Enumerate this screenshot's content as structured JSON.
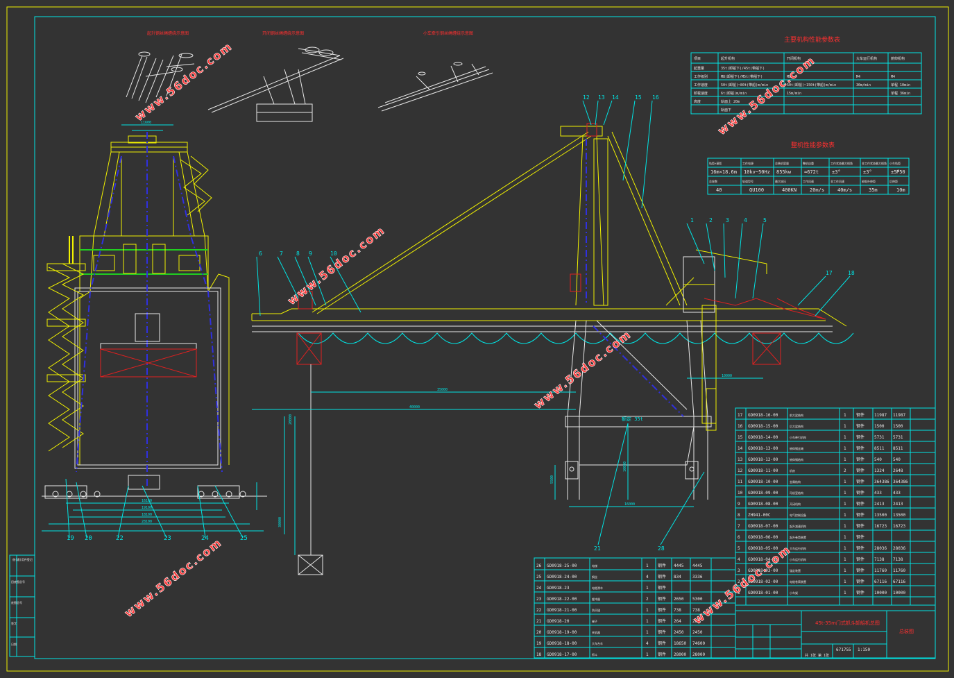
{
  "watermark": "www.56doc.com",
  "detail_titles": [
    "起升钢丝绳缠绕示意图",
    "开闭钢丝绳缠绕示意图",
    "小车牵引钢丝绳缠绕示意图"
  ],
  "main_params": {
    "title": "主要机构性能参数表",
    "header": [
      "项目",
      "起升机构",
      "开闭机构",
      "大车运行机构",
      "俯仰机构"
    ],
    "rows": [
      [
        "起重量",
        "35t(卸船下)/45t(带船下)",
        "",
        "",
        ""
      ],
      [
        "工作级别",
        "M8(卸船下)/M5t(带船下)",
        "M8",
        "M4",
        "M4"
      ],
      [
        "工作速度",
        "50t(卸船)~80t(带船)m/min",
        "50t(卸船)~150t(带船)m/min",
        "30m/min",
        "单程 10min"
      ],
      [
        "卸载速度",
        "6t(卸船)m/min",
        "15m/min",
        "",
        "单程 36min"
      ],
      [
        "高度",
        "轨面上 20m",
        "",
        "",
        ""
      ],
      [
        "",
        "轨面下",
        "",
        "",
        ""
      ]
    ]
  },
  "overall_params": {
    "title": "整机性能参数表",
    "row1_head": [
      "轨距×基距",
      "工作电源",
      "总装机容量",
      "整机自重",
      "工作状态最大倾角",
      "非工作状态最大倾角",
      "小车轨距"
    ],
    "row1_vals": [
      "16m×18.6m",
      "10kv~50Hz",
      "855kw",
      "≈672t",
      "±3°",
      "±3°",
      "±5°",
      "P50"
    ],
    "row2_head": [
      "总轮数",
      "轨道型号",
      "最大轮压",
      "工作风速",
      "非工作风速",
      "卸船外伸距",
      "后伸距"
    ],
    "row2_vals": [
      "40",
      "QU100",
      "400KN",
      "20m/s",
      "40m/s",
      "35m",
      "10m"
    ]
  },
  "dimensions": {
    "front_width": "28100",
    "front_base": [
      "16100",
      "19100",
      "18100",
      "28100"
    ],
    "front_top": "11600",
    "side_reach": "40000",
    "side_trolley": "35000",
    "side_back": "10000",
    "side_portal": "16000",
    "side_height": "20000",
    "side_lower": "30000",
    "side_leg": "10000",
    "side_small": "5500",
    "side_rated": "额定 35t"
  },
  "balloons_side": [
    "12",
    "13",
    "14",
    "15",
    "16",
    "1",
    "2",
    "3",
    "4",
    "5",
    "6",
    "7",
    "8",
    "9",
    "10",
    "17",
    "18",
    "21",
    "28"
  ],
  "balloons_front": [
    "19",
    "20",
    "22",
    "23",
    "24",
    "25"
  ],
  "bom_right": [
    [
      "17",
      "GD0918-16-00",
      "前大梁结构",
      "1",
      "钢件",
      "11987",
      "11987"
    ],
    [
      "16",
      "GD0918-15-00",
      "后大梁结构",
      "1",
      "钢件",
      "1500",
      "1500"
    ],
    [
      "15",
      "GD0918-14-00",
      "小车牵引机构",
      "1",
      "钢件",
      "5731",
      "5731"
    ],
    [
      "14",
      "GD0918-13-00",
      "俯仰钢丝绳",
      "1",
      "钢件",
      "8511",
      "8511"
    ],
    [
      "13",
      "GD0918-12-00",
      "俯仰钢结构",
      "1",
      "钢件",
      "540",
      "540"
    ],
    [
      "12",
      "GD0918-11-00",
      "机房",
      "2",
      "钢件",
      "1324",
      "2648"
    ],
    [
      "11",
      "GD0918-10-00",
      "金属结构",
      "1",
      "钢件",
      "364386",
      "364386"
    ],
    [
      "10",
      "GD0918-09-00",
      "司机室结构",
      "1",
      "钢件",
      "433",
      "433"
    ],
    [
      "9",
      "GD0918-08-00",
      "开闭机构",
      "1",
      "钢件",
      "2413",
      "2413"
    ],
    [
      "8",
      "ZH941-00C",
      "电气控制设备",
      "1",
      "钢件",
      "13500",
      "13500"
    ],
    [
      "7",
      "GD0918-07-00",
      "起升减速机构",
      "1",
      "钢件",
      "16723",
      "16723"
    ],
    [
      "6",
      "GD0918-06-00",
      "起升卷筒装置",
      "1",
      "钢件",
      "",
      ""
    ],
    [
      "5",
      "GD0918-05-00",
      "大车运行机构",
      "1",
      "钢件",
      "28036",
      "28036"
    ],
    [
      "4",
      "GD0918-04-00",
      "小车运行机构",
      "1",
      "钢件",
      "7138",
      "7138"
    ],
    [
      "3",
      "GD0918-03-00",
      "锚定装置",
      "1",
      "钢件",
      "11760",
      "11760"
    ],
    [
      "2",
      "GD0918-02-00",
      "电缆卷筒装置",
      "1",
      "钢件",
      "67116",
      "67116"
    ],
    [
      "1",
      "GD0918-01-00",
      "小车架",
      "1",
      "钢件",
      "10000",
      "10000"
    ]
  ],
  "bom_left": [
    [
      "26",
      "GD0918-25-00",
      "电梯",
      "1",
      "钢件",
      "4445",
      "4445"
    ],
    [
      "25",
      "GD0918-24-00",
      "钢丝",
      "4",
      "钢件",
      "834",
      "3336"
    ],
    [
      "24",
      "GD0918-23",
      "电缆滑车",
      "1",
      "钢件",
      "",
      ""
    ],
    [
      "23",
      "GD0918-22-00",
      "缓冲器",
      "2",
      "钢件",
      "2650",
      "5300"
    ],
    [
      "22",
      "GD0918-21-00",
      "防风锚",
      "1",
      "钢件",
      "738",
      "738"
    ],
    [
      "21",
      "GD0918-20",
      "梯子",
      "1",
      "钢件",
      "264",
      "264"
    ],
    [
      "20",
      "GD0918-19-00",
      "夹轨器",
      "1",
      "钢件",
      "2450",
      "2450"
    ],
    [
      "19",
      "GD0918-18-00",
      "大车台车",
      "4",
      "钢件",
      "18650",
      "74600"
    ],
    [
      "18",
      "GD0918-17-00",
      "抓斗",
      "1",
      "钢件",
      "28000",
      "28000"
    ]
  ],
  "title_block": {
    "drawing_title": "45t-35m门式抓斗卸船机总图",
    "label": "总装图",
    "scale": "1:150",
    "weight": "671755",
    "sheet": "共 1张 第 1张"
  },
  "left_margin_box": [
    "借(通)用件登记",
    "旧底图总号",
    "底图总号",
    "签字",
    "日期"
  ]
}
